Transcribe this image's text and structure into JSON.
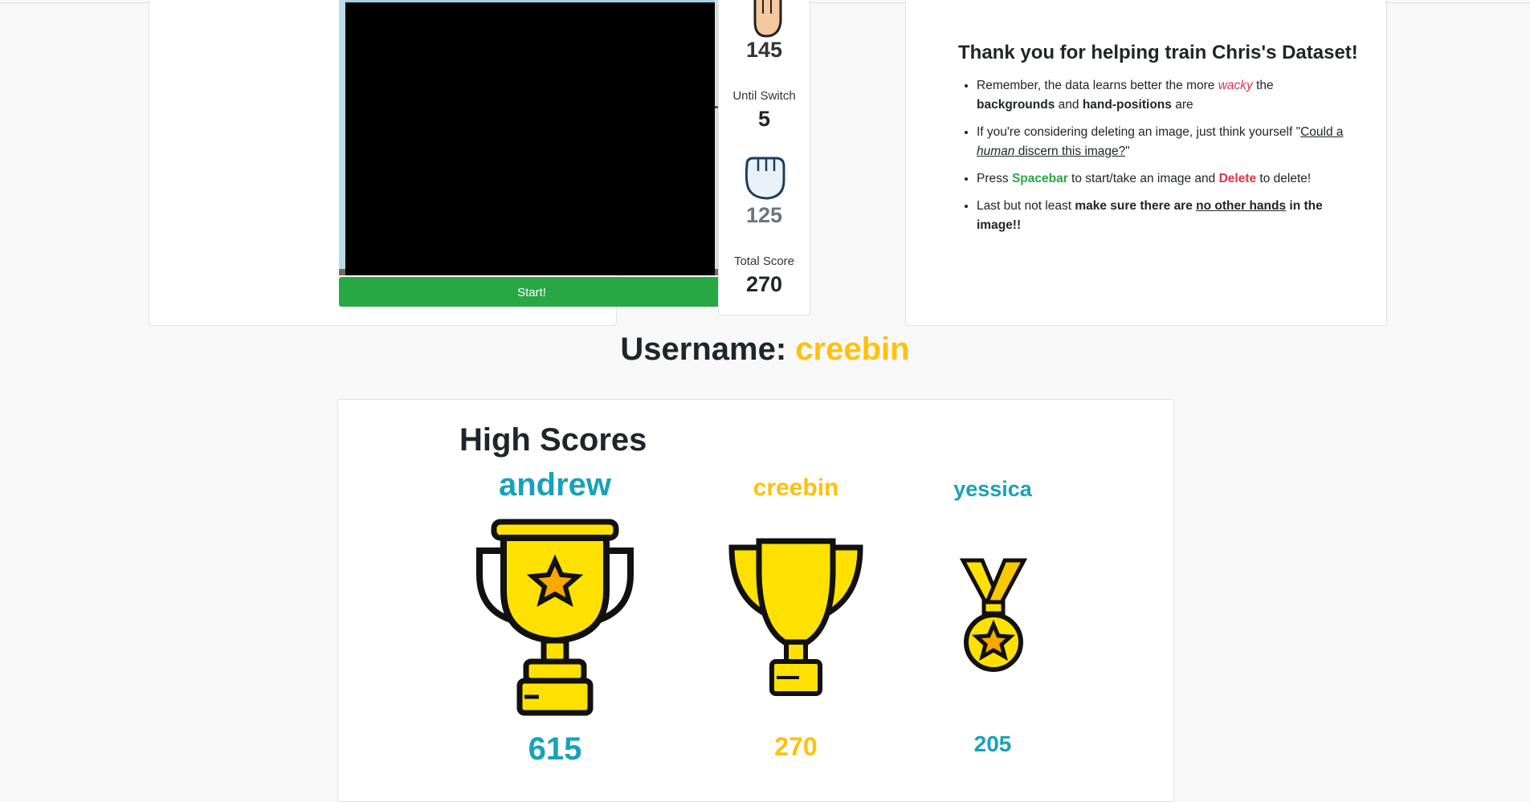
{
  "camera": {
    "start_label": "Start!"
  },
  "counters": {
    "open_hand_count": "145",
    "until_switch_label": "Until Switch",
    "until_switch_value": "5",
    "fist_count": "125",
    "total_score_label": "Total Score",
    "total_score_value": "270"
  },
  "info": {
    "title": "Thank you for helping train Chris's Dataset!",
    "bullet1": {
      "a": "Remember, the data learns better the more ",
      "wacky": "wacky",
      "b": " the ",
      "backgrounds": "backgrounds",
      "c": " and ",
      "hand_positions": "hand-positions",
      "d": " are"
    },
    "bullet2": {
      "a": "If you're considering deleting an image, just think yourself \"",
      "u1": "Could a ",
      "human": "human",
      "u2": " discern this image?",
      "b": "\""
    },
    "bullet3": {
      "a": "Press ",
      "spacebar": "Spacebar",
      "b": " to start/take an image and ",
      "delete": "Delete",
      "c": " to delete!"
    },
    "bullet4": {
      "a": "Last but not least ",
      "b": "make sure there are ",
      "c": "no other hands",
      "d": " in the image!!"
    }
  },
  "user": {
    "label": "Username: ",
    "name": "creebin"
  },
  "high_scores": {
    "title": "High Scores",
    "entries": [
      {
        "name": "andrew",
        "score": "615",
        "award": "gold-trophy-icon"
      },
      {
        "name": "creebin",
        "score": "270",
        "award": "silver-trophy-icon"
      },
      {
        "name": "yessica",
        "score": "205",
        "award": "medal-icon"
      }
    ]
  },
  "colors": {
    "green": "#28a745",
    "red": "#dc3545",
    "teal": "#17a2b8",
    "yellow": "#ffc107",
    "trophy": "#ffe100"
  }
}
